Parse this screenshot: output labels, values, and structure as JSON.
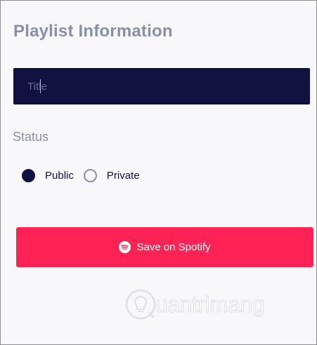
{
  "form": {
    "heading": "Playlist Information",
    "title_field": {
      "placeholder": "Title",
      "value": ""
    },
    "status_label": "Status",
    "status_options": [
      {
        "label": "Public",
        "selected": true
      },
      {
        "label": "Private",
        "selected": false
      }
    ],
    "save_button_label": "Save on Spotify"
  },
  "watermark": {
    "text": "uantrimang"
  },
  "colors": {
    "heading": "#8a8ea8",
    "input_background": "#121240",
    "accent_button": "#ff2355",
    "radio_checked": "#121240"
  },
  "icons": {
    "button": "spotify-icon",
    "watermark": "lightbulb-icon"
  }
}
